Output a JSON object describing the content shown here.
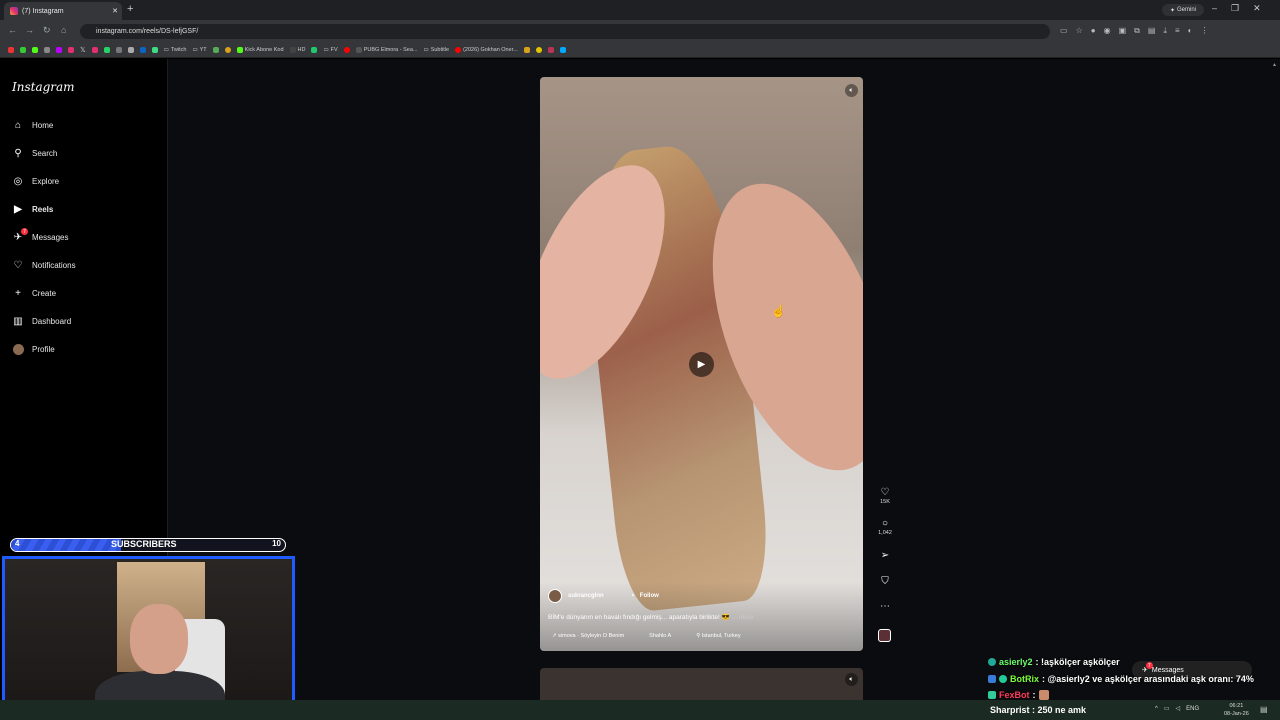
{
  "browser": {
    "tab_title": "(7) Instagram",
    "new_tab": "+",
    "gemini_label": "Gemini",
    "window_controls": [
      "–",
      "❐",
      "✕"
    ],
    "url": "instagram.com/reels/DS-lefjGSF/",
    "bookmarks": [
      "Twitch",
      "YT",
      "Kick Abone Kod",
      "HD",
      "FV",
      "PUBG Elmora - Sea...",
      "Subtitle",
      "(2026) Gokhan Oner..."
    ]
  },
  "instagram": {
    "logo": "Instagram",
    "nav": [
      {
        "label": "Home",
        "icon": "home-icon"
      },
      {
        "label": "Search",
        "icon": "search-icon"
      },
      {
        "label": "Explore",
        "icon": "compass-icon"
      },
      {
        "label": "Reels",
        "icon": "reels-icon",
        "active": true
      },
      {
        "label": "Messages",
        "icon": "messenger-icon",
        "badge": "7"
      },
      {
        "label": "Notifications",
        "icon": "heart-icon"
      },
      {
        "label": "Create",
        "icon": "plus-icon"
      },
      {
        "label": "Dashboard",
        "icon": "dashboard-icon"
      },
      {
        "label": "Profile",
        "icon": "avatar"
      }
    ],
    "reel": {
      "username": "sukrancglnn",
      "follow": "Follow",
      "caption": "BİM'e dünyanın en havalı fındığı gelmiş... aparatıyla birlikte! 😎",
      "more": "... more",
      "music": "simova · Söyleyin O Benim",
      "tagged": "Shahlo A",
      "location": "Istanbul, Turkey"
    },
    "actions": {
      "likes": "15K",
      "comments": "1,042"
    }
  },
  "stream_overlay": {
    "subs_current": "4",
    "subs_label": "SUBSCRIBERS",
    "subs_goal": "10",
    "subs_progress": 0.4,
    "chat": [
      {
        "user": "asierly2",
        "color": "#6cff6c",
        "text": ": !aşkölçer aşkölçer"
      },
      {
        "user": "BotRix",
        "color": "#7cff3c",
        "text": ": @asierly2 ve aşkölçer arasındaki aşk oranı: 74%"
      },
      {
        "user": "FexBot",
        "color": "#ff3b5c",
        "text": ":"
      }
    ],
    "messages_pill": "Messages",
    "messages_badge": "7"
  },
  "taskbar": {
    "notice_user": "Sharprist",
    "notice_text": ": 250 ne amk",
    "lang": "ENG",
    "time": "06:21",
    "date": "08-Jan-26"
  },
  "colors": {
    "accent": "#1f5bff",
    "badge": "#ff3040"
  }
}
